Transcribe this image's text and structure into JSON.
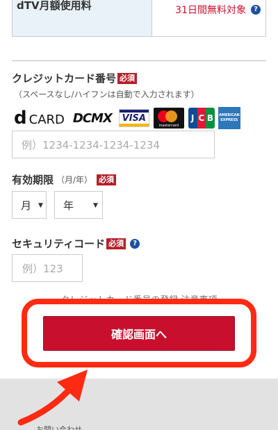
{
  "fee": {
    "label": "dTV月額使用料",
    "value": "31日間無料対象",
    "help": "?"
  },
  "card_number": {
    "title": "クレジットカード番号",
    "required": "必須",
    "note": "（スペースなし/ハイフンは自動で入力されます）",
    "placeholder": "例）1234-1234-1234-1234",
    "brands": {
      "dcard_d": "d",
      "dcard_text": "CARD",
      "dcmx": "DCMX",
      "visa": "VISA",
      "mastercard": "mastercard",
      "jcb_j": "J",
      "jcb_c": "C",
      "jcb_b": "B",
      "amex_1": "AMERICAN",
      "amex_2": "EXPRESS"
    }
  },
  "expiry": {
    "title": "有効期限",
    "sub": "（月/年）",
    "required": "必須",
    "month": "月",
    "year": "年",
    "arrow": "▼"
  },
  "security": {
    "title": "セキュリティコード",
    "required": "必須",
    "help": "?",
    "placeholder": "例）123"
  },
  "notice_link": "クレジットカード番号の登録 注意事項",
  "submit_label": "確認画面へ",
  "contact": "お問い合わせ",
  "colors": {
    "accent": "#c8102e",
    "highlight": "#ff2a12",
    "help": "#1f4f9e"
  }
}
